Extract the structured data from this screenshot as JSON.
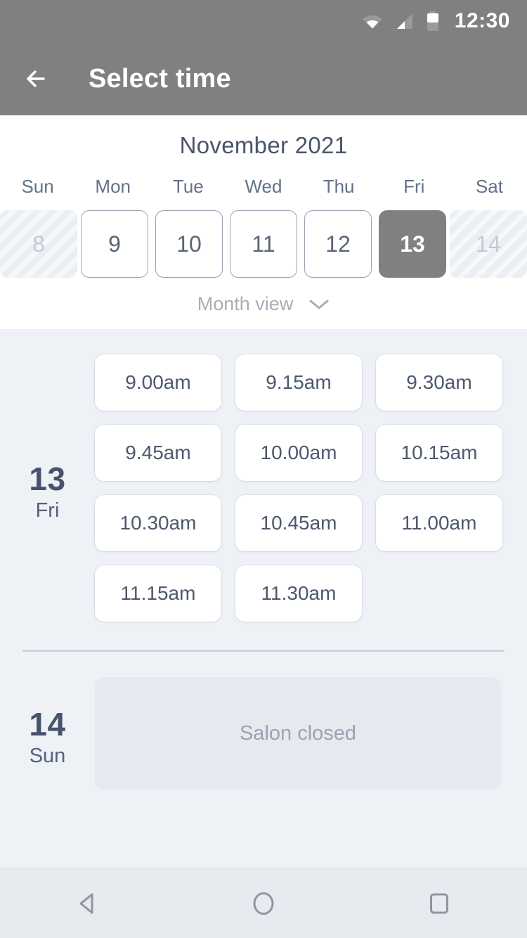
{
  "status_bar": {
    "time": "12:30",
    "icons": [
      "wifi-icon",
      "signal-icon",
      "battery-icon"
    ]
  },
  "app_bar": {
    "back_label": "back-arrow-icon",
    "title": "Select time"
  },
  "calendar": {
    "month_title": "November 2021",
    "weekdays": [
      "Sun",
      "Mon",
      "Tue",
      "Wed",
      "Thu",
      "Fri",
      "Sat"
    ],
    "days": [
      {
        "number": "8",
        "state": "disabled"
      },
      {
        "number": "9",
        "state": "normal"
      },
      {
        "number": "10",
        "state": "normal"
      },
      {
        "number": "11",
        "state": "normal"
      },
      {
        "number": "12",
        "state": "normal"
      },
      {
        "number": "13",
        "state": "selected"
      },
      {
        "number": "14",
        "state": "disabled"
      }
    ],
    "view_toggle": {
      "label": "Month view",
      "icon": "chevron-down-icon"
    },
    "selected_color": "#808080",
    "accent_text_color": "#4a5568"
  },
  "schedule": [
    {
      "day_number": "13",
      "day_name": "Fri",
      "slots": [
        "9.00am",
        "9.15am",
        "9.30am",
        "9.45am",
        "10.00am",
        "10.15am",
        "10.30am",
        "10.45am",
        "11.00am",
        "11.15am",
        "11.30am"
      ]
    },
    {
      "day_number": "14",
      "day_name": "Sun",
      "closed_message": "Salon closed"
    }
  ],
  "nav_bar": {
    "buttons": [
      "back-triangle-icon",
      "home-circle-icon",
      "recents-square-icon"
    ]
  }
}
